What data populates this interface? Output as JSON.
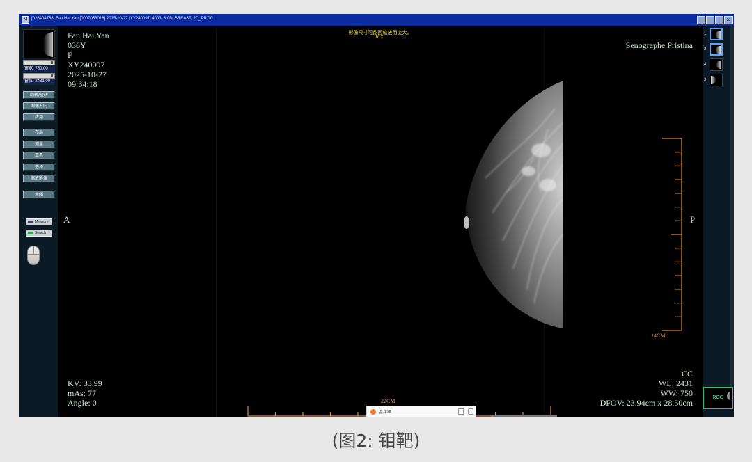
{
  "window": {
    "title": "[026404788] Fan Hai Yan [0007053018] 2025-10-27 [XY240097] 4003, 3:0D, BREAST, 2D_PROC",
    "app_icon": "M"
  },
  "window_buttons": {
    "b1": "",
    "b2": "",
    "b3": "",
    "b4": "×"
  },
  "left_panel": {
    "level_top": "窗宽: 750.00",
    "level_bottom": "窗位: 2431.00",
    "buttons": [
      "翻转/旋转",
      "图像方向",
      "应用",
      "布局",
      "测量",
      "工具",
      "选择",
      "缩放影像",
      "关闭"
    ],
    "tools": {
      "measure": "Measure",
      "search": "Search"
    }
  },
  "patient": {
    "name": "Fan Hai Yan",
    "age": "036Y",
    "sex": "F",
    "id": "XY240097",
    "date": "2025-10-27",
    "time": "09:34:18"
  },
  "device": "Senographe Pristina",
  "warning": "影像尺寸可能因缩放而变大。",
  "view_tag": "RCC",
  "orientation": {
    "left": "A",
    "right": "P"
  },
  "exposure": {
    "kv": "KV: 33.99",
    "mas": "mAs: 77",
    "angle": "Angle: 0"
  },
  "image_info": {
    "view": "CC",
    "wl": "WL: 2431",
    "ww": "WW: 750",
    "dfov": "DFOV: 23.94cm x 28.50cm"
  },
  "scales": {
    "horizontal": "22CM",
    "vertical": "14CM"
  },
  "right_panel": {
    "thumbs": [
      {
        "num": "1",
        "side": "r"
      },
      {
        "num": "2",
        "side": "r"
      },
      {
        "num": "4",
        "side": "r"
      },
      {
        "num": "3",
        "side": "l"
      }
    ],
    "selected_label": "RCC"
  },
  "popup": {
    "text": "金年丰"
  },
  "caption": "(图2: 钼靶)"
}
